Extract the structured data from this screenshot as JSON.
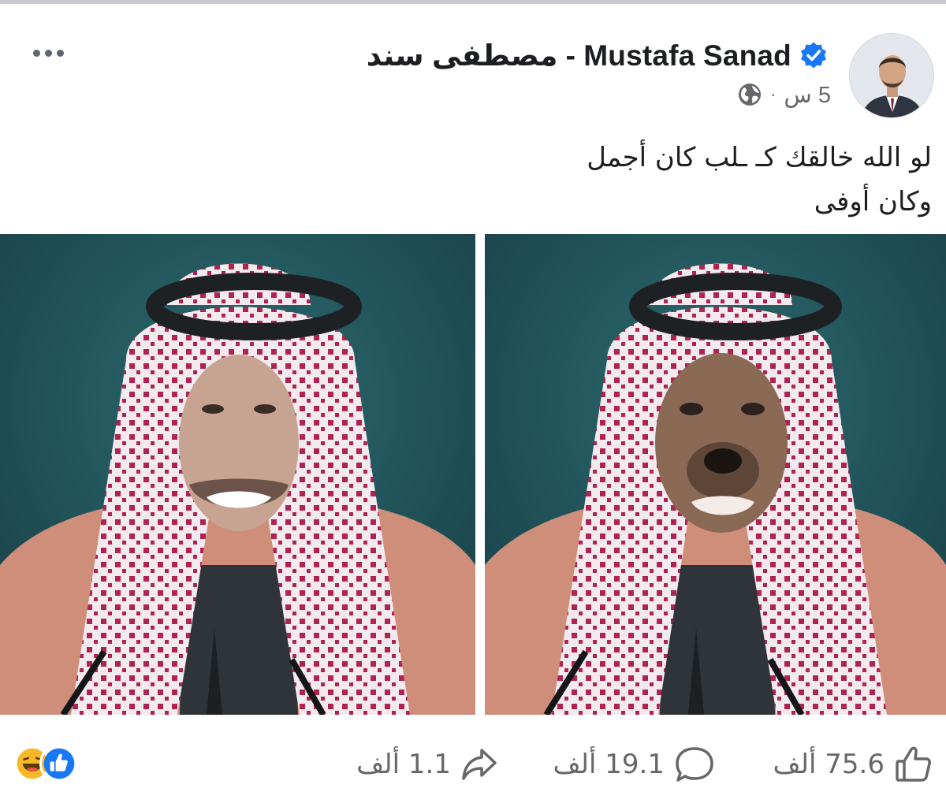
{
  "post": {
    "author_name": "مصطفى سند - Mustafa Sanad",
    "time": "5 س",
    "meta_separator": "·",
    "text_line1": "لو الله خالقك كـ ـلب كان أجمل",
    "text_line2": "وكان أوفى"
  },
  "stats": {
    "likes": "75.6 ألف",
    "comments": "19.1 ألف",
    "shares": "1.1 ألف"
  },
  "colors": {
    "verified": "#1877f2",
    "like_reaction": "#1877f2",
    "haha_reaction": "#f7b928",
    "photo_background": "#1d4f55"
  },
  "icons": [
    "more-options-icon",
    "verified-badge-icon",
    "globe-icon",
    "like-icon",
    "comment-icon",
    "share-icon",
    "like-reaction-icon",
    "haha-reaction-icon"
  ]
}
